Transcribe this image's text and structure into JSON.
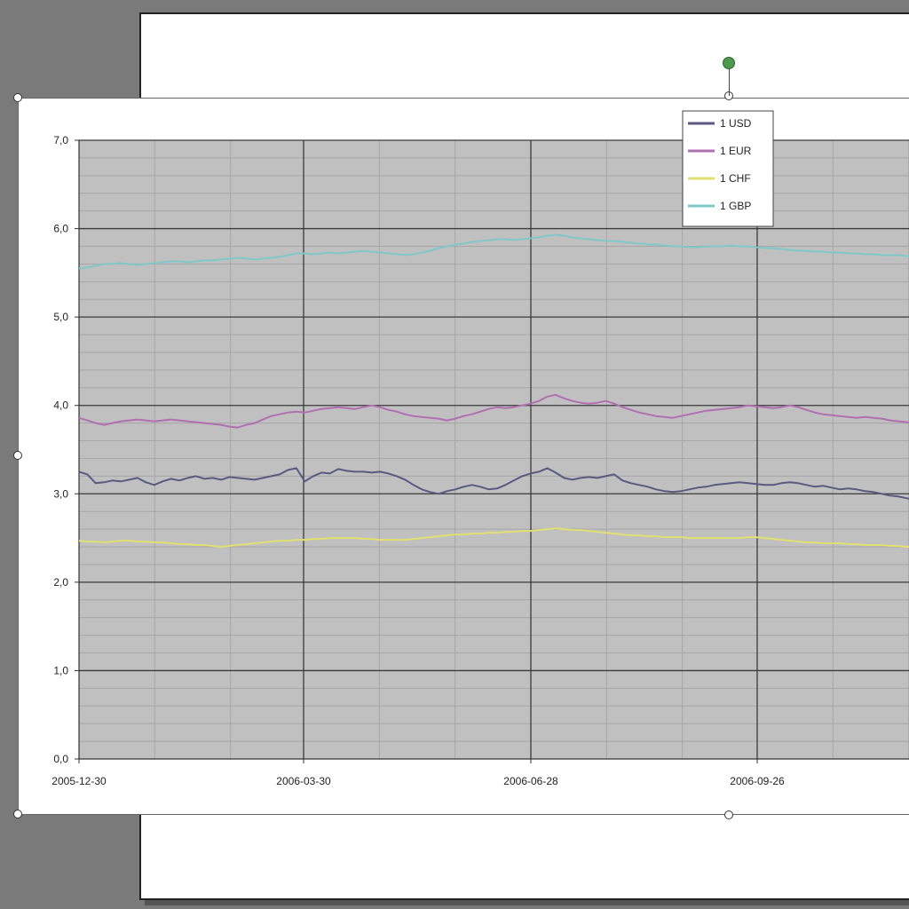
{
  "chart_data": {
    "type": "line",
    "title": "",
    "xlabel": "",
    "ylabel": "",
    "x_tick_labels": [
      "2005-12-30",
      "2006-03-30",
      "2006-06-28",
      "2006-09-26"
    ],
    "y_tick_labels": [
      "0,0",
      "1,0",
      "2,0",
      "3,0",
      "4,0",
      "5,0",
      "6,0",
      "7,0"
    ],
    "ylim": [
      0,
      7
    ],
    "grid": true,
    "legend_position": "top-right",
    "plot_background": "#c0c0c0",
    "series": [
      {
        "name": "1 USD",
        "color": "#5a5a80",
        "values": [
          3.25,
          3.22,
          3.12,
          3.13,
          3.15,
          3.14,
          3.16,
          3.18,
          3.13,
          3.1,
          3.14,
          3.17,
          3.15,
          3.18,
          3.2,
          3.17,
          3.18,
          3.16,
          3.19,
          3.18,
          3.17,
          3.16,
          3.18,
          3.2,
          3.22,
          3.27,
          3.29,
          3.14,
          3.2,
          3.24,
          3.23,
          3.28,
          3.26,
          3.25,
          3.25,
          3.24,
          3.25,
          3.23,
          3.2,
          3.16,
          3.1,
          3.05,
          3.02,
          3.0,
          3.03,
          3.05,
          3.08,
          3.1,
          3.08,
          3.05,
          3.06,
          3.1,
          3.15,
          3.2,
          3.23,
          3.25,
          3.29,
          3.24,
          3.18,
          3.16,
          3.18,
          3.19,
          3.18,
          3.2,
          3.22,
          3.15,
          3.12,
          3.1,
          3.08,
          3.05,
          3.03,
          3.02,
          3.03,
          3.05,
          3.07,
          3.08,
          3.1,
          3.11,
          3.12,
          3.13,
          3.12,
          3.11,
          3.1,
          3.1,
          3.12,
          3.13,
          3.12,
          3.1,
          3.08,
          3.09,
          3.07,
          3.05,
          3.06,
          3.05,
          3.03,
          3.02,
          3.0,
          2.98,
          2.97,
          2.95,
          2.93
        ]
      },
      {
        "name": "1 EUR",
        "color": "#b070b0",
        "values": [
          3.86,
          3.83,
          3.8,
          3.78,
          3.8,
          3.82,
          3.83,
          3.84,
          3.83,
          3.82,
          3.83,
          3.84,
          3.83,
          3.82,
          3.81,
          3.8,
          3.79,
          3.78,
          3.76,
          3.75,
          3.78,
          3.8,
          3.84,
          3.88,
          3.9,
          3.92,
          3.93,
          3.92,
          3.94,
          3.96,
          3.97,
          3.98,
          3.97,
          3.96,
          3.98,
          4.0,
          3.98,
          3.95,
          3.93,
          3.9,
          3.88,
          3.87,
          3.86,
          3.85,
          3.83,
          3.85,
          3.88,
          3.9,
          3.93,
          3.96,
          3.98,
          3.97,
          3.98,
          4.0,
          4.02,
          4.05,
          4.1,
          4.12,
          4.08,
          4.05,
          4.03,
          4.02,
          4.03,
          4.05,
          4.02,
          3.98,
          3.95,
          3.92,
          3.9,
          3.88,
          3.87,
          3.86,
          3.88,
          3.9,
          3.92,
          3.94,
          3.95,
          3.96,
          3.97,
          3.98,
          4.0,
          3.99,
          3.98,
          3.97,
          3.98,
          4.0,
          3.98,
          3.95,
          3.92,
          3.9,
          3.89,
          3.88,
          3.87,
          3.86,
          3.87,
          3.86,
          3.85,
          3.83,
          3.82,
          3.81,
          3.8
        ]
      },
      {
        "name": "1 CHF",
        "color": "#e0e070",
        "values": [
          2.47,
          2.46,
          2.46,
          2.45,
          2.46,
          2.47,
          2.47,
          2.46,
          2.46,
          2.45,
          2.45,
          2.44,
          2.43,
          2.43,
          2.42,
          2.42,
          2.41,
          2.4,
          2.41,
          2.42,
          2.43,
          2.44,
          2.45,
          2.46,
          2.47,
          2.47,
          2.48,
          2.48,
          2.49,
          2.49,
          2.5,
          2.5,
          2.5,
          2.5,
          2.49,
          2.49,
          2.48,
          2.48,
          2.48,
          2.48,
          2.49,
          2.5,
          2.51,
          2.52,
          2.53,
          2.54,
          2.54,
          2.55,
          2.55,
          2.56,
          2.56,
          2.57,
          2.57,
          2.58,
          2.58,
          2.59,
          2.6,
          2.61,
          2.6,
          2.59,
          2.59,
          2.58,
          2.57,
          2.56,
          2.55,
          2.54,
          2.53,
          2.53,
          2.52,
          2.52,
          2.51,
          2.51,
          2.51,
          2.5,
          2.5,
          2.5,
          2.5,
          2.5,
          2.5,
          2.5,
          2.51,
          2.51,
          2.5,
          2.49,
          2.48,
          2.47,
          2.46,
          2.45,
          2.45,
          2.44,
          2.44,
          2.44,
          2.43,
          2.43,
          2.42,
          2.42,
          2.42,
          2.41,
          2.41,
          2.4,
          2.4
        ]
      },
      {
        "name": "1 GBP",
        "color": "#80c8c8",
        "values": [
          5.55,
          5.56,
          5.58,
          5.6,
          5.6,
          5.61,
          5.6,
          5.59,
          5.6,
          5.61,
          5.62,
          5.63,
          5.63,
          5.62,
          5.63,
          5.64,
          5.64,
          5.65,
          5.66,
          5.67,
          5.66,
          5.65,
          5.66,
          5.67,
          5.68,
          5.7,
          5.72,
          5.72,
          5.71,
          5.72,
          5.73,
          5.72,
          5.73,
          5.74,
          5.75,
          5.74,
          5.73,
          5.72,
          5.71,
          5.7,
          5.71,
          5.73,
          5.75,
          5.78,
          5.8,
          5.82,
          5.83,
          5.85,
          5.86,
          5.87,
          5.88,
          5.88,
          5.87,
          5.88,
          5.89,
          5.9,
          5.92,
          5.93,
          5.92,
          5.9,
          5.89,
          5.88,
          5.87,
          5.86,
          5.86,
          5.85,
          5.84,
          5.83,
          5.82,
          5.82,
          5.81,
          5.8,
          5.8,
          5.79,
          5.79,
          5.8,
          5.8,
          5.8,
          5.81,
          5.8,
          5.8,
          5.79,
          5.78,
          5.78,
          5.77,
          5.76,
          5.75,
          5.75,
          5.74,
          5.74,
          5.73,
          5.73,
          5.72,
          5.72,
          5.71,
          5.71,
          5.7,
          5.7,
          5.7,
          5.69,
          5.69
        ]
      }
    ]
  }
}
